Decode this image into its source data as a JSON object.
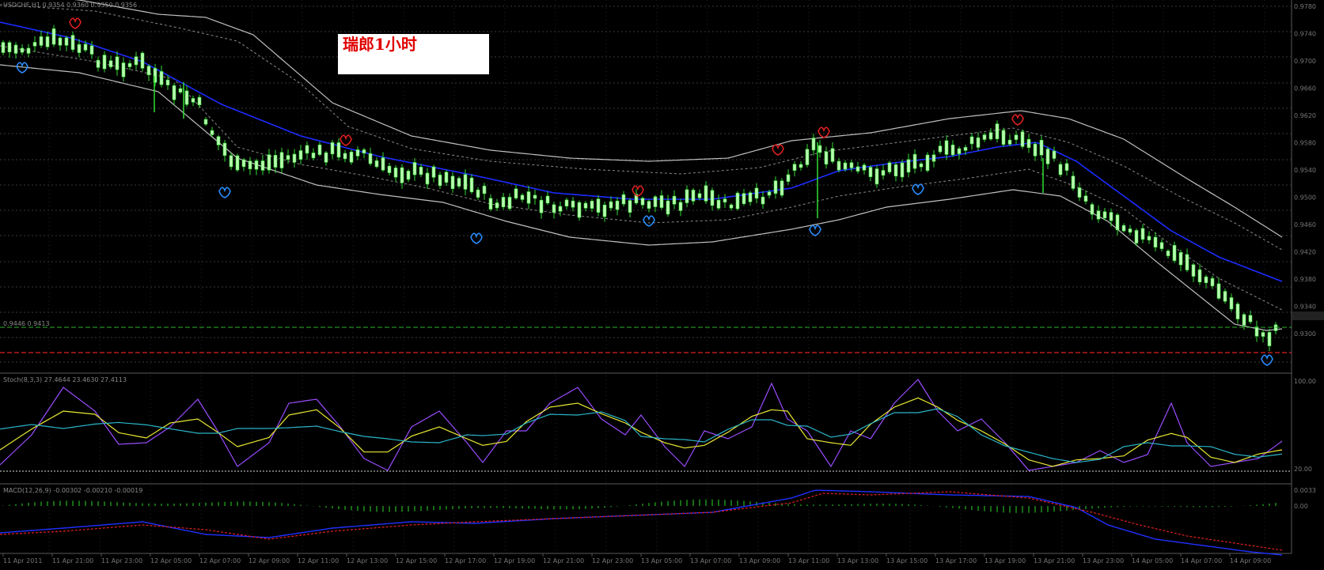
{
  "window": {
    "symbol_header": "USDCHF,H1  0.9354 0.9360 0.9350 0.9356",
    "note_text": "瑞郎1小时"
  },
  "panes": {
    "price": {
      "level_label": "0.9446 0.9413"
    },
    "stoch": {
      "header": "Stoch(8,3,3) 27.4644 23.4630 27.4113"
    },
    "macd": {
      "header": "MACD(12,26,9) -0.00302 -0.00210 -0.00019"
    }
  },
  "colors": {
    "background": "#000000",
    "grid": "#3a3a3a",
    "bull_candle": "#b8ffb0",
    "wick": "#33dd33",
    "ma_blue": "#1c2cff",
    "band_outer": "#c0c0c0",
    "band_inner": "#8a8a8a",
    "stoch_main": "#9a4cff",
    "stoch_k": "#e8e832",
    "stoch_d": "#2ab5c8",
    "macd_red": "#e02020",
    "macd_blue": "#2030ff",
    "hist_green": "#1f9a1f",
    "level_green": "#2bb52b",
    "level_red": "#e02020",
    "fractal_up": "#e02020",
    "fractal_down": "#2a8cff"
  },
  "price_axis": [
    "0.9780",
    "0.9740",
    "0.9700",
    "0.9660",
    "0.9620",
    "0.9580",
    "0.9540",
    "0.9500",
    "0.9460",
    "0.9420",
    "0.9380",
    "0.9340",
    "0.9300"
  ],
  "stoch_axis": [
    "100.00",
    "80.00",
    "20.00"
  ],
  "macd_axis": [
    "0.0033",
    "0.00"
  ],
  "time_axis": [
    "11 Apr 2011",
    "11 Apr 21:00",
    "11 Apr 23:00",
    "12 Apr 05:00",
    "12 Apr 07:00",
    "12 Apr 09:00",
    "12 Apr 11:00",
    "12 Apr 13:00",
    "12 Apr 15:00",
    "12 Apr 17:00",
    "12 Apr 19:00",
    "12 Apr 21:00",
    "12 Apr 23:00",
    "13 Apr 05:00",
    "13 Apr 07:00",
    "13 Apr 09:00",
    "13 Apr 11:00",
    "13 Apr 13:00",
    "13 Apr 15:00",
    "13 Apr 17:00",
    "13 Apr 19:00",
    "13 Apr 21:00",
    "13 Apr 23:00",
    "14 Apr 05:00",
    "14 Apr 07:00",
    "14 Apr 09:00",
    "14 Apr 11:00"
  ]
}
